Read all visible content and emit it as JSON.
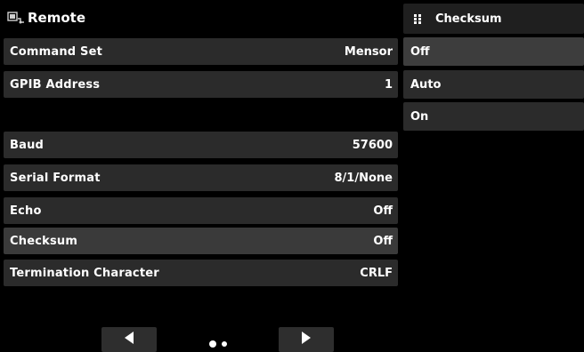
{
  "header": {
    "title": "Remote",
    "icon": "remote-interface-icon"
  },
  "settings": [
    {
      "key": "command-set",
      "label": "Command Set",
      "value": "Mensor"
    },
    {
      "key": "gpib-address",
      "label": "GPIB Address",
      "value": "1"
    },
    {
      "key": "baud",
      "label": "Baud",
      "value": "57600"
    },
    {
      "key": "serial-format",
      "label": "Serial Format",
      "value": "8/1/None"
    },
    {
      "key": "echo",
      "label": "Echo",
      "value": "Off"
    },
    {
      "key": "checksum",
      "label": "Checksum",
      "value": "Off",
      "selected": true
    },
    {
      "key": "termination-character",
      "label": "Termination Character",
      "value": "CRLF"
    }
  ],
  "panel": {
    "title": "Checksum",
    "icon": "grid-icon",
    "options": [
      {
        "label": "Off",
        "selected": true
      },
      {
        "label": "Auto"
      },
      {
        "label": "On"
      }
    ]
  },
  "pager": {
    "current_page": 1,
    "page_count": 2
  },
  "colors": {
    "background": "#000000",
    "row": "#2b2b2b",
    "row_selected": "#3a3a3a",
    "text": "#ffffff"
  }
}
